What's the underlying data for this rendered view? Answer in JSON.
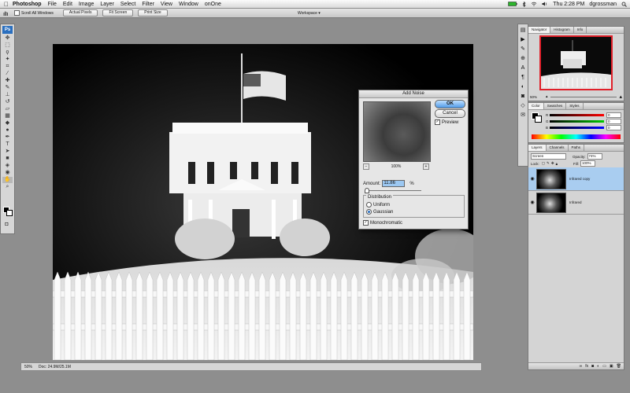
{
  "menubar": {
    "apple": "",
    "app_name": "Photoshop",
    "items": [
      "File",
      "Edit",
      "Image",
      "Layer",
      "Select",
      "Filter",
      "View",
      "Window",
      "onOne"
    ],
    "clock": "Thu 2:28 PM",
    "user": "dgrossman"
  },
  "options_bar": {
    "scroll_all_label": "Scroll All Windows",
    "actual_pixels": "Actual Pixels",
    "fit_screen": "Fit Screen",
    "print_size": "Print Size",
    "workspace": "Workspace ▾"
  },
  "status_bar": {
    "zoom": "50%",
    "doc_info": "Doc: 24.9M/25.1M"
  },
  "dialog": {
    "title": "Add Noise",
    "ok_label": "OK",
    "cancel_label": "Cancel",
    "preview_label": "Preview",
    "preview_zoom": "100%",
    "amount_label": "Amount:",
    "amount_value": "11.86",
    "amount_unit": "%",
    "amount_fraction": 0.03,
    "distribution_label": "Distribution",
    "uniform_label": "Uniform",
    "gaussian_label": "Gaussian",
    "monochromatic_label": "Monochromatic"
  },
  "navigator_panel": {
    "tabs": [
      "Navigator",
      "Histogram",
      "Info"
    ],
    "zoom": "50%"
  },
  "color_panel": {
    "tabs": [
      "Color",
      "Swatches",
      "Styles"
    ],
    "channels": [
      {
        "label": "R",
        "value": "0"
      },
      {
        "label": "G",
        "value": "0"
      },
      {
        "label": "B",
        "value": "0"
      }
    ]
  },
  "layers_panel": {
    "tabs": [
      "Layers",
      "Channels",
      "Paths"
    ],
    "blend_mode": "Screen",
    "opacity_label": "Opacity:",
    "opacity_value": "74%",
    "lock_label": "Lock:",
    "fill_label": "Fill:",
    "fill_value": "100%",
    "layers": [
      {
        "name": "Infrared copy",
        "selected": true
      },
      {
        "name": "Infrared",
        "selected": false
      }
    ]
  },
  "colors": {
    "accent": "#2a6fbf",
    "selected_layer": "#a9cdf0",
    "nav_box": "#e0202a"
  }
}
